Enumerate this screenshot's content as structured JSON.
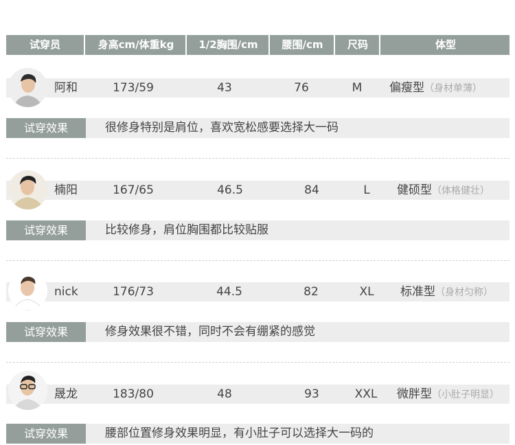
{
  "header": {
    "tester": "试穿员",
    "height_weight": "身高cm/体重kg",
    "half_chest": "1/2胸围/cm",
    "waist": "腰围/cm",
    "size": "尺码",
    "body_type": "体型"
  },
  "rows": [
    {
      "name": "阿和",
      "hw": "173/59",
      "chest": "43",
      "waist": "76",
      "size": "M",
      "type": "偏瘦型",
      "type_note": "（身材单薄）",
      "effect_label": "试穿效果",
      "effect_text": "很修身特别是肩位，喜欢宽松感要选择大一码"
    },
    {
      "name": "楠阳",
      "hw": "167/65",
      "chest": "46.5",
      "waist": "84",
      "size": "L",
      "type": "健硕型",
      "type_note": "（体格健壮）",
      "effect_label": "试穿效果",
      "effect_text": "比较修身，肩位胸围都比较贴服"
    },
    {
      "name": "nick",
      "hw": "176/73",
      "chest": "44.5",
      "waist": "82",
      "size": "XL",
      "type": "标准型",
      "type_note": "（身材匀称）",
      "effect_label": "试穿效果",
      "effect_text": "修身效果很不错，同时不会有绷紧的感觉"
    },
    {
      "name": "晟龙",
      "hw": "183/80",
      "chest": "48",
      "waist": "93",
      "size": "XXL",
      "type": "微胖型",
      "type_note": "（小肚子明显）",
      "effect_label": "试穿效果",
      "effect_text": "腰部位置修身效果明显，有小肚子可以选择大一码的"
    }
  ],
  "colors": {
    "header_bg": "#949f9b",
    "band_bg": "#ededee",
    "note_color": "#aaaaaa"
  }
}
